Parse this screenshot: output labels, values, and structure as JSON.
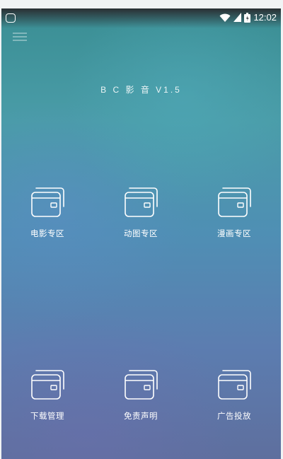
{
  "status_bar": {
    "time": "12:02",
    "icons": [
      "app-icon",
      "wifi-icon",
      "signal-icon",
      "battery-icon"
    ]
  },
  "toolbar": {
    "menu_icon": "hamburger-menu-icon"
  },
  "app": {
    "title": "B C 影 音 V1.5"
  },
  "tiles": [
    {
      "label": "电影专区",
      "icon": "wallet-icon"
    },
    {
      "label": "动图专区",
      "icon": "wallet-icon"
    },
    {
      "label": "漫画专区",
      "icon": "wallet-icon"
    },
    {
      "label": "下载管理",
      "icon": "wallet-icon"
    },
    {
      "label": "免责声明",
      "icon": "wallet-icon"
    },
    {
      "label": "广告投放",
      "icon": "wallet-icon"
    }
  ],
  "colors": {
    "background_top": "#3a8e93",
    "background_bottom": "#5e6f9e",
    "foreground": "#ffffff"
  }
}
